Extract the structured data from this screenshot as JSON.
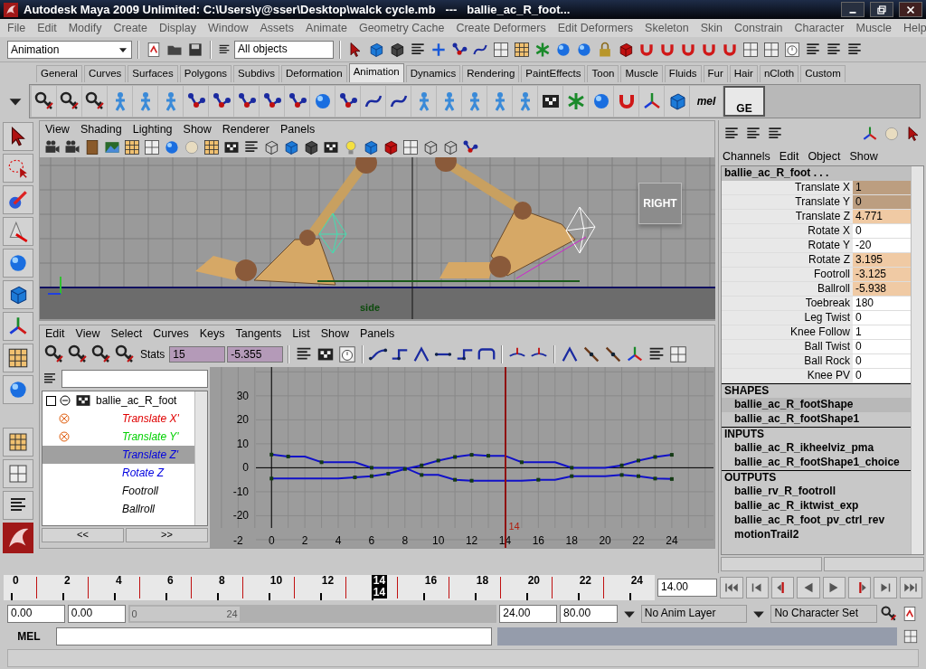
{
  "window": {
    "title": "Autodesk Maya 2009 Unlimited: C:\\Users\\y@sser\\Desktop\\walck cycle.mb   ---   ballie_ac_R_foot..."
  },
  "menu_bar": [
    "File",
    "Edit",
    "Modify",
    "Create",
    "Display",
    "Window",
    "Assets",
    "Animate",
    "Geometry Cache",
    "Create Deformers",
    "Edit Deformers",
    "Skeleton",
    "Skin",
    "Constrain",
    "Character",
    "Muscle",
    "Help"
  ],
  "status_line": {
    "menu_set": "Animation",
    "selection_field": "All objects"
  },
  "shelf": {
    "tabs": [
      {
        "label": "General",
        "selected": false
      },
      {
        "label": "Curves",
        "selected": false
      },
      {
        "label": "Surfaces",
        "selected": false
      },
      {
        "label": "Polygons",
        "selected": false
      },
      {
        "label": "Subdivs",
        "selected": false
      },
      {
        "label": "Deformation",
        "selected": false
      },
      {
        "label": "Animation",
        "selected": true
      },
      {
        "label": "Dynamics",
        "selected": false
      },
      {
        "label": "Rendering",
        "selected": false
      },
      {
        "label": "PaintEffects",
        "selected": false
      },
      {
        "label": "Toon",
        "selected": false
      },
      {
        "label": "Muscle",
        "selected": false
      },
      {
        "label": "Fluids",
        "selected": false
      },
      {
        "label": "Fur",
        "selected": false
      },
      {
        "label": "Hair",
        "selected": false
      },
      {
        "label": "nCloth",
        "selected": false
      },
      {
        "label": "Custom",
        "selected": false
      }
    ],
    "mel_label": "mel",
    "ge_label": "GE"
  },
  "viewport": {
    "menu": [
      "View",
      "Shading",
      "Lighting",
      "Show",
      "Renderer",
      "Panels"
    ],
    "view_cube": "RIGHT",
    "camera": "side"
  },
  "graph_editor": {
    "menu": [
      "Edit",
      "View",
      "Select",
      "Curves",
      "Keys",
      "Tangents",
      "List",
      "Show",
      "Panels"
    ],
    "stats_label": "Stats",
    "stats": [
      "15",
      "-5.355"
    ],
    "outliner": {
      "label": "ballie_ac_R_foot",
      "expanded": true,
      "children": [
        {
          "label": "Translate X'",
          "color": "#e00000",
          "flagged": true,
          "selected": false
        },
        {
          "label": "Translate Y'",
          "color": "#00d000",
          "flagged": true,
          "selected": false
        },
        {
          "label": "Translate Z'",
          "color": "#0000e0",
          "flagged": false,
          "selected": true
        },
        {
          "label": "Rotate Z",
          "color": "#0000e0",
          "flagged": false,
          "selected": false
        },
        {
          "label": "Footroll",
          "color": "#000000",
          "flagged": false,
          "selected": false
        },
        {
          "label": "Ballroll",
          "color": "#000000",
          "flagged": false,
          "selected": false
        }
      ]
    },
    "scroll_buttons": [
      "<<",
      ">>"
    ],
    "current_time": "14",
    "chart_data": {
      "type": "line",
      "x": [
        0,
        1,
        2,
        3,
        4,
        5,
        6,
        7,
        8,
        9,
        10,
        11,
        12,
        13,
        14,
        15,
        16,
        17,
        18,
        19,
        20,
        21,
        22,
        23,
        24
      ],
      "xlim": [
        -3.7,
        26.5
      ],
      "ylim": [
        -33.4,
        42
      ],
      "grid": true,
      "xticks": [
        -2,
        0,
        2,
        4,
        6,
        8,
        10,
        12,
        14,
        16,
        18,
        20,
        22,
        24
      ],
      "yticks": [
        -20,
        -10,
        0,
        10,
        20,
        30
      ],
      "series": [
        {
          "color": "#1010c8",
          "values": [
            5.5,
            4.7,
            4.7,
            2.3,
            2.3,
            2.3,
            0,
            0,
            0,
            -3,
            -3,
            -5,
            -5.4,
            -5.4,
            -5.4,
            -5.4,
            -5,
            -5,
            -3.5,
            -3.5,
            -3.5,
            -3,
            -3.5,
            -4.5,
            -4.7
          ]
        },
        {
          "color": "#1010c8",
          "values": [
            -4.5,
            -4.5,
            -4.5,
            -4.5,
            -4.5,
            -4,
            -3.5,
            -2.5,
            -0.5,
            1,
            3,
            4.5,
            5.4,
            5,
            5,
            2.3,
            2.3,
            2.3,
            0,
            0,
            0,
            1,
            3,
            4.5,
            5.4
          ]
        }
      ]
    }
  },
  "channel_box": {
    "menu": [
      "Channels",
      "Edit",
      "Object",
      "Show"
    ],
    "object": "ballie_ac_R_foot . . .",
    "channels": [
      {
        "name": "Translate X",
        "value": "1",
        "keyed": true,
        "selected": true
      },
      {
        "name": "Translate Y",
        "value": "0",
        "keyed": true,
        "selected": true
      },
      {
        "name": "Translate Z",
        "value": "4.771",
        "keyed": true,
        "selected": false
      },
      {
        "name": "Rotate X",
        "value": "0",
        "keyed": false,
        "selected": false
      },
      {
        "name": "Rotate Y",
        "value": "-20",
        "keyed": false,
        "selected": false
      },
      {
        "name": "Rotate Z",
        "value": "3.195",
        "keyed": true,
        "selected": false
      },
      {
        "name": "Footroll",
        "value": "-3.125",
        "keyed": true,
        "selected": false
      },
      {
        "name": "Ballroll",
        "value": "-5.938",
        "keyed": true,
        "selected": false
      },
      {
        "name": "Toebreak",
        "value": "180",
        "keyed": false,
        "selected": false
      },
      {
        "name": "Leg Twist",
        "value": "0",
        "keyed": false,
        "selected": false
      },
      {
        "name": "Knee Follow",
        "value": "1",
        "keyed": false,
        "selected": false
      },
      {
        "name": "Ball Twist",
        "value": "0",
        "keyed": false,
        "selected": false
      },
      {
        "name": "Ball Rock",
        "value": "0",
        "keyed": false,
        "selected": false
      },
      {
        "name": "Knee PV",
        "value": "0",
        "keyed": false,
        "selected": false
      }
    ],
    "sections": [
      {
        "title": "SHAPES",
        "items": [
          {
            "label": "ballie_ac_R_footShape",
            "selected": true
          },
          {
            "label": "ballie_ac_R_footShape1",
            "selected": false
          }
        ]
      },
      {
        "title": "INPUTS",
        "items": [
          {
            "label": "ballie_ac_R_ikheelviz_pma",
            "selected": false
          },
          {
            "label": "ballie_ac_R_footShape1_choice",
            "selected": false
          }
        ]
      },
      {
        "title": "OUTPUTS",
        "items": [
          {
            "label": "ballie_rv_R_footroll",
            "selected": false
          },
          {
            "label": "ballie_ac_R_iktwist_exp",
            "selected": false
          },
          {
            "label": "ballie_ac_R_foot_pv_ctrl_rev",
            "selected": false
          },
          {
            "label": "motionTrail2",
            "selected": false
          }
        ]
      }
    ]
  },
  "time_slider": {
    "ticks": [
      {
        "label": "0",
        "selected": false
      },
      {
        "label": "2",
        "selected": false
      },
      {
        "label": "4",
        "selected": false
      },
      {
        "label": "6",
        "selected": false
      },
      {
        "label": "8",
        "selected": false
      },
      {
        "label": "10",
        "selected": false
      },
      {
        "label": "12",
        "selected": false
      },
      {
        "label": "14",
        "selected": true,
        "lower_label": "14"
      },
      {
        "label": "16",
        "selected": false
      },
      {
        "label": "18",
        "selected": false
      },
      {
        "label": "20",
        "selected": false
      },
      {
        "label": "22",
        "selected": false
      },
      {
        "label": "24",
        "selected": false
      }
    ],
    "current_field": "14.00"
  },
  "range_slider": {
    "start": "0.00",
    "playback_start": "0.00",
    "level": 0.3,
    "bar_start": "0",
    "bar_end": "24",
    "playback_end": "24.00",
    "end": "80.00",
    "anim_layer": "No Anim Layer",
    "character_set": "No Character Set"
  },
  "command_line": {
    "label": "MEL"
  }
}
